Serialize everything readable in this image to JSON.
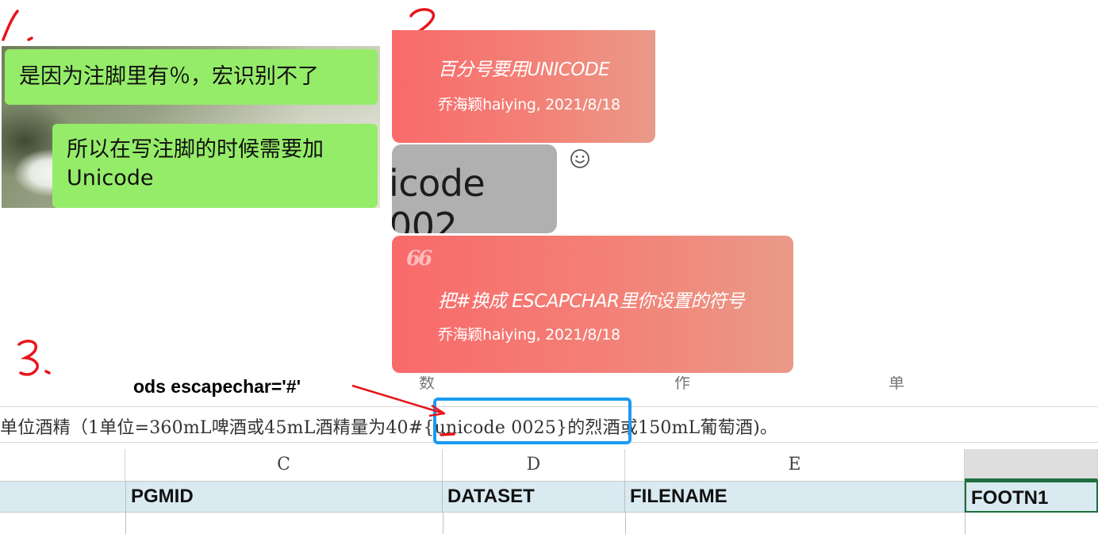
{
  "annotations": {
    "step1": "1.",
    "step2": "2.",
    "step3": "3.",
    "escapechar_label": "ods escapechar='#'",
    "colors": {
      "hand": "#e8141b",
      "box": "#1a9bf0"
    }
  },
  "chat": {
    "messages": [
      {
        "text": "是因为注脚里有％，宏识别不了"
      },
      {
        "line1": "所以在写注脚的时候需要加",
        "line2": "Unicode"
      }
    ]
  },
  "quotes": {
    "card1": {
      "text": "百分号要用UNICODE",
      "author": "乔海颖haiying, 2021/8/18"
    },
    "snippet": "icode 002",
    "card2": {
      "mark": "66",
      "text": "把#换成 ESCAPCHAR里你设置的符号",
      "author": "乔海颖haiying, 2021/8/18"
    },
    "colors": {
      "start": "#f96a6a",
      "end": "#ea9a88"
    }
  },
  "sheet": {
    "formula_prefix": "单位酒精（1单位=360mL啤酒或45mL酒精量为40",
    "formula_hash": "#",
    "formula_unicode": "{unicode 0025}",
    "formula_suffix": "的烈酒或150mL葡萄酒)。",
    "partial_top": [
      "数",
      "作",
      "单"
    ],
    "columns": [
      {
        "letter": "C",
        "field": "PGMID"
      },
      {
        "letter": "D",
        "field": "DATASET"
      },
      {
        "letter": "E",
        "field": "FILENAME"
      },
      {
        "letter": "",
        "field": "FOOTN1"
      }
    ],
    "row_header_color": "#d9eaf1"
  }
}
